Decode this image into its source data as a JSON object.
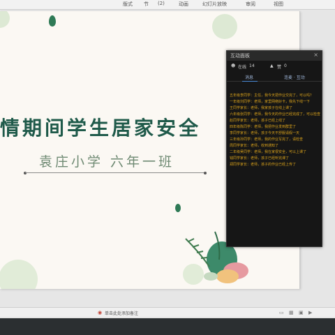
{
  "ribbon": {
    "items": [
      "版式",
      "节",
      "(2)",
      "动画",
      "幻灯片放映",
      "审阅",
      "视图"
    ]
  },
  "slide": {
    "title": "情期间学生居家安全",
    "subtitle": "袁庄小学 六年一班"
  },
  "panel": {
    "title": "互动面板",
    "close_icon": "×",
    "online_label": "在线",
    "online_count": "14",
    "likes_label": "赞",
    "likes_count": "0",
    "tab_chat": "消息",
    "tab_interact": "连麦 · 互动",
    "messages": [
      "五年级李同学：主任，我今天把作业交完了，可以吗？",
      "一年级刘同学：老师，家里网络好卡，我先下线一下",
      "王同学家长：老师，我家孩子在线上课了",
      "六年级张同学：老师，我今天的作业已经完成了，可以检查",
      "赵同学家长：老师，孩子已经上线了",
      "四年级陈同学：老师，我把作业发到群里了",
      "李同学家长：老师，孩子今天不舒服请假一天",
      "三年级孙同学：老师，我的作业写完了，请检查",
      "周同学家长：老师，收到通知了",
      "二年级吴同学：老师，我在家很安全，可以上课了",
      "钱同学家长：老师，孩子已经听完课了",
      "郑同学家长：老师，孩子的作业已经上传了"
    ]
  },
  "statusbar": {
    "notes_label": "单击此处添加备注",
    "view_icons": [
      "▭",
      "▦",
      "▣",
      "▶"
    ]
  }
}
